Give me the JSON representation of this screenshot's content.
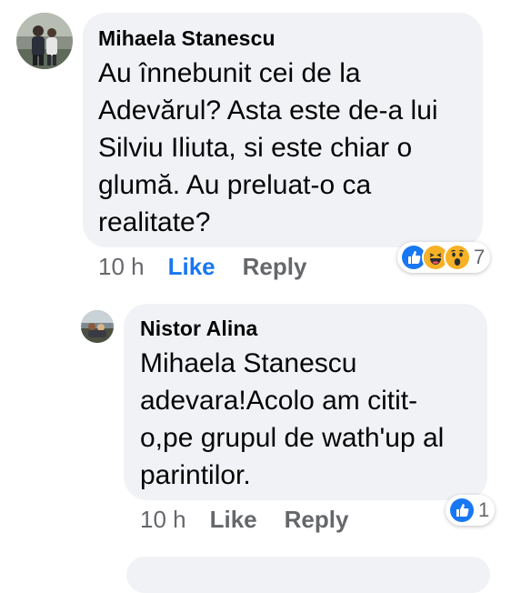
{
  "comments": [
    {
      "author": "Mihaela Stanescu",
      "text": "Au înnebunit cei de la\nAdevărul? Asta este de-a lui\nSilviu Iliuta, si este chiar o\nglumă. Au preluat-o ca\nrealitate?",
      "time": "10 h",
      "like_label": "Like",
      "reply_label": "Reply",
      "reaction_icons": [
        "like-reaction-icon",
        "haha-reaction-icon",
        "wow-reaction-icon"
      ],
      "reaction_count": "7"
    },
    {
      "author": "Nistor Alina",
      "text": "Mihaela Stanescu\nadevara!Acolo am citit-\no,pe grupul de wath'up al\nparintilor.",
      "time": "10 h",
      "like_label": "Like",
      "reply_label": "Reply",
      "reaction_icons": [
        "like-reaction-icon"
      ],
      "reaction_count": "1"
    }
  ],
  "colors": {
    "bubble": "#f0f2f5",
    "link_blue": "#1877f2",
    "secondary_text": "#65676b",
    "like_reaction": "#1877f2",
    "haha_wow_reaction": "#f7b125"
  }
}
